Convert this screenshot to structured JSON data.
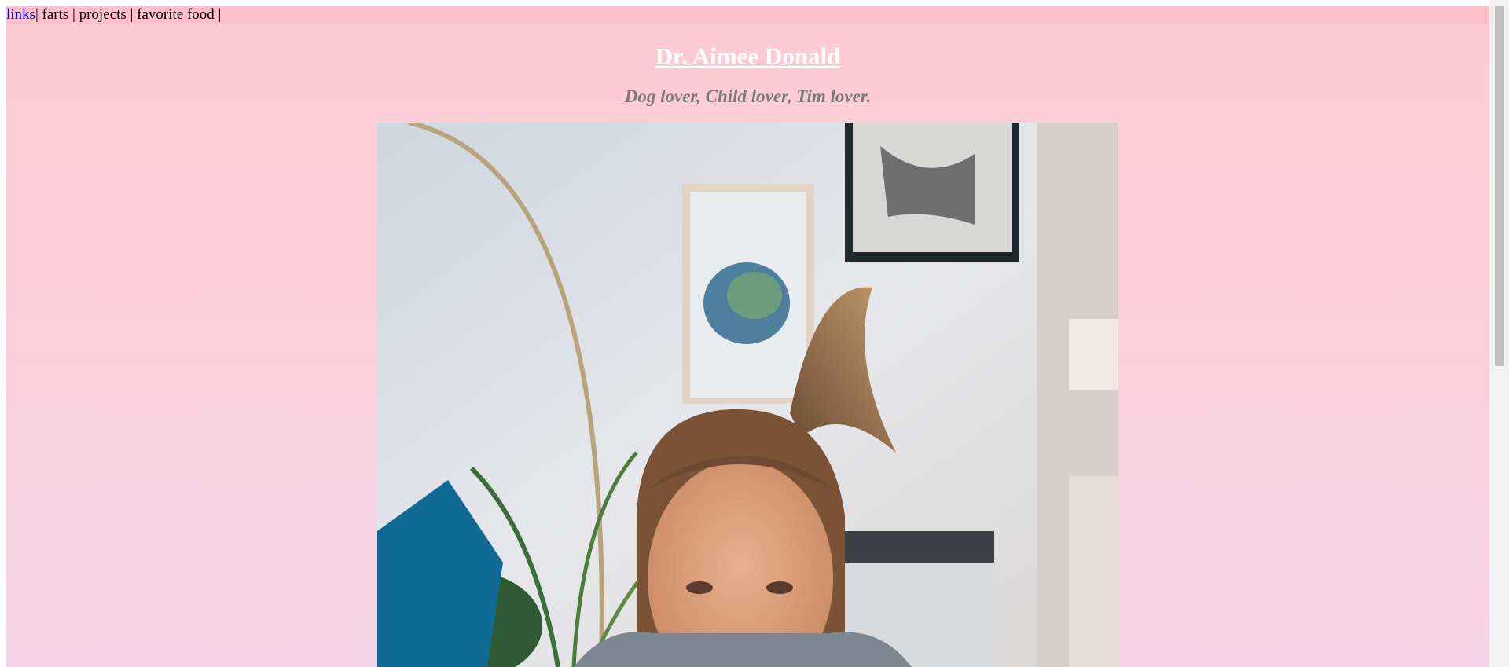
{
  "nav": {
    "links_label": "links",
    "items": [
      "farts",
      "projects",
      "favorite food"
    ],
    "separator": "|"
  },
  "header": {
    "title": "Dr. Aimee Donald",
    "subtitle": "Dog lover, Child lover, Tim lover."
  },
  "colors": {
    "background_top": "#fecad3",
    "background_bottom": "#f4d4e4",
    "navbar": "#ffc0cc",
    "title": "#ffffff",
    "subtitle": "#7a7a7a",
    "link": "#0000ee"
  }
}
